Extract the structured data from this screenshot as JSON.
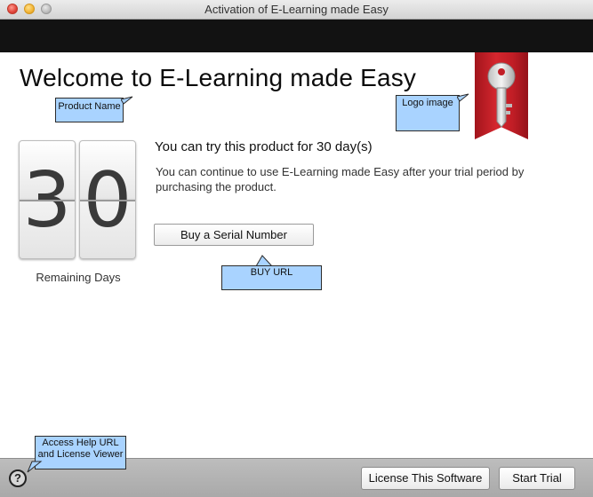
{
  "window": {
    "title": "Activation of E-Learning made Easy"
  },
  "header": {
    "title": "Welcome to E-Learning made Easy"
  },
  "callouts": {
    "product_name": "Product Name",
    "logo_image": "Logo image",
    "buy_url": "BUY URL",
    "help": "Access Help URL and License Viewer"
  },
  "countdown": {
    "digits": [
      "3",
      "0"
    ],
    "label": "Remaining Days"
  },
  "trial": {
    "title": "You can try this product for 30 day(s)",
    "description": "You can continue to use E-Learning made Easy after your trial period by purchasing the product.",
    "buy_button": "Buy a Serial Number"
  },
  "footer": {
    "help_label": "?",
    "license_button": "License This Software",
    "start_button": "Start Trial"
  },
  "colors": {
    "callout": "#a9d3ff",
    "ribbon": "#c21e26",
    "darkband": "#121212"
  }
}
